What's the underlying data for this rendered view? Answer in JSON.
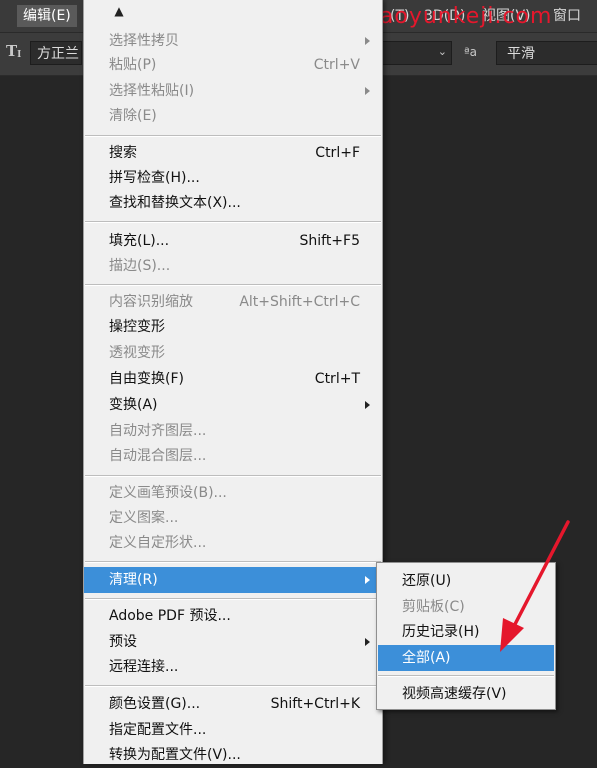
{
  "menubar": {
    "edit": "编辑(E)",
    "type_menu_tail": "(T)",
    "menu_3d": "3D(D)",
    "view": "视图(V)",
    "window": "窗口"
  },
  "watermark": "www.haoyunkeji.com",
  "options_bar": {
    "font_family": "方正兰",
    "aa_icon": "ªa",
    "anti_alias": "平滑"
  },
  "menu": {
    "scroll_up": "▲",
    "items": [
      {
        "label": "选择性拷贝",
        "shortcut": "",
        "disabled": true,
        "submenu": true
      },
      {
        "label": "粘贴(P)",
        "shortcut": "Ctrl+V",
        "disabled": true,
        "submenu": false
      },
      {
        "label": "选择性粘贴(I)",
        "shortcut": "",
        "disabled": true,
        "submenu": true
      },
      {
        "label": "清除(E)",
        "shortcut": "",
        "disabled": true,
        "submenu": false
      },
      {
        "label": "搜索",
        "shortcut": "Ctrl+F",
        "disabled": false,
        "submenu": false
      },
      {
        "label": "拼写检查(H)...",
        "shortcut": "",
        "disabled": false,
        "submenu": false
      },
      {
        "label": "查找和替换文本(X)...",
        "shortcut": "",
        "disabled": false,
        "submenu": false
      },
      {
        "label": "填充(L)...",
        "shortcut": "Shift+F5",
        "disabled": false,
        "submenu": false
      },
      {
        "label": "描边(S)...",
        "shortcut": "",
        "disabled": true,
        "submenu": false
      },
      {
        "label": "内容识别缩放",
        "shortcut": "Alt+Shift+Ctrl+C",
        "disabled": true,
        "submenu": false
      },
      {
        "label": "操控变形",
        "shortcut": "",
        "disabled": false,
        "submenu": false
      },
      {
        "label": "透视变形",
        "shortcut": "",
        "disabled": true,
        "submenu": false
      },
      {
        "label": "自由变换(F)",
        "shortcut": "Ctrl+T",
        "disabled": false,
        "submenu": false
      },
      {
        "label": "变换(A)",
        "shortcut": "",
        "disabled": false,
        "submenu": true
      },
      {
        "label": "自动对齐图层...",
        "shortcut": "",
        "disabled": true,
        "submenu": false
      },
      {
        "label": "自动混合图层...",
        "shortcut": "",
        "disabled": true,
        "submenu": false
      },
      {
        "label": "定义画笔预设(B)...",
        "shortcut": "",
        "disabled": true,
        "submenu": false
      },
      {
        "label": "定义图案...",
        "shortcut": "",
        "disabled": true,
        "submenu": false
      },
      {
        "label": "定义自定形状...",
        "shortcut": "",
        "disabled": true,
        "submenu": false
      },
      {
        "label": "清理(R)",
        "shortcut": "",
        "disabled": false,
        "submenu": true,
        "highlight": true
      },
      {
        "label": "Adobe PDF 预设...",
        "shortcut": "",
        "disabled": false,
        "submenu": false
      },
      {
        "label": "预设",
        "shortcut": "",
        "disabled": false,
        "submenu": true
      },
      {
        "label": "远程连接...",
        "shortcut": "",
        "disabled": false,
        "submenu": false
      },
      {
        "label": "颜色设置(G)...",
        "shortcut": "Shift+Ctrl+K",
        "disabled": false,
        "submenu": false
      },
      {
        "label": "指定配置文件...",
        "shortcut": "",
        "disabled": false,
        "submenu": false
      },
      {
        "label": "转换为配置文件(V)...",
        "shortcut": "",
        "disabled": false,
        "submenu": false
      }
    ]
  },
  "submenu": {
    "items": [
      {
        "label": "还原(U)",
        "disabled": false
      },
      {
        "label": "剪贴板(C)",
        "disabled": true
      },
      {
        "label": "历史记录(H)",
        "disabled": false
      },
      {
        "label": "全部(A)",
        "disabled": false,
        "highlight": true
      },
      {
        "label": "视频高速缓存(V)",
        "disabled": false
      }
    ]
  },
  "colors": {
    "highlight": "#3c8fd9",
    "annotation_arrow": "#e5172c"
  }
}
